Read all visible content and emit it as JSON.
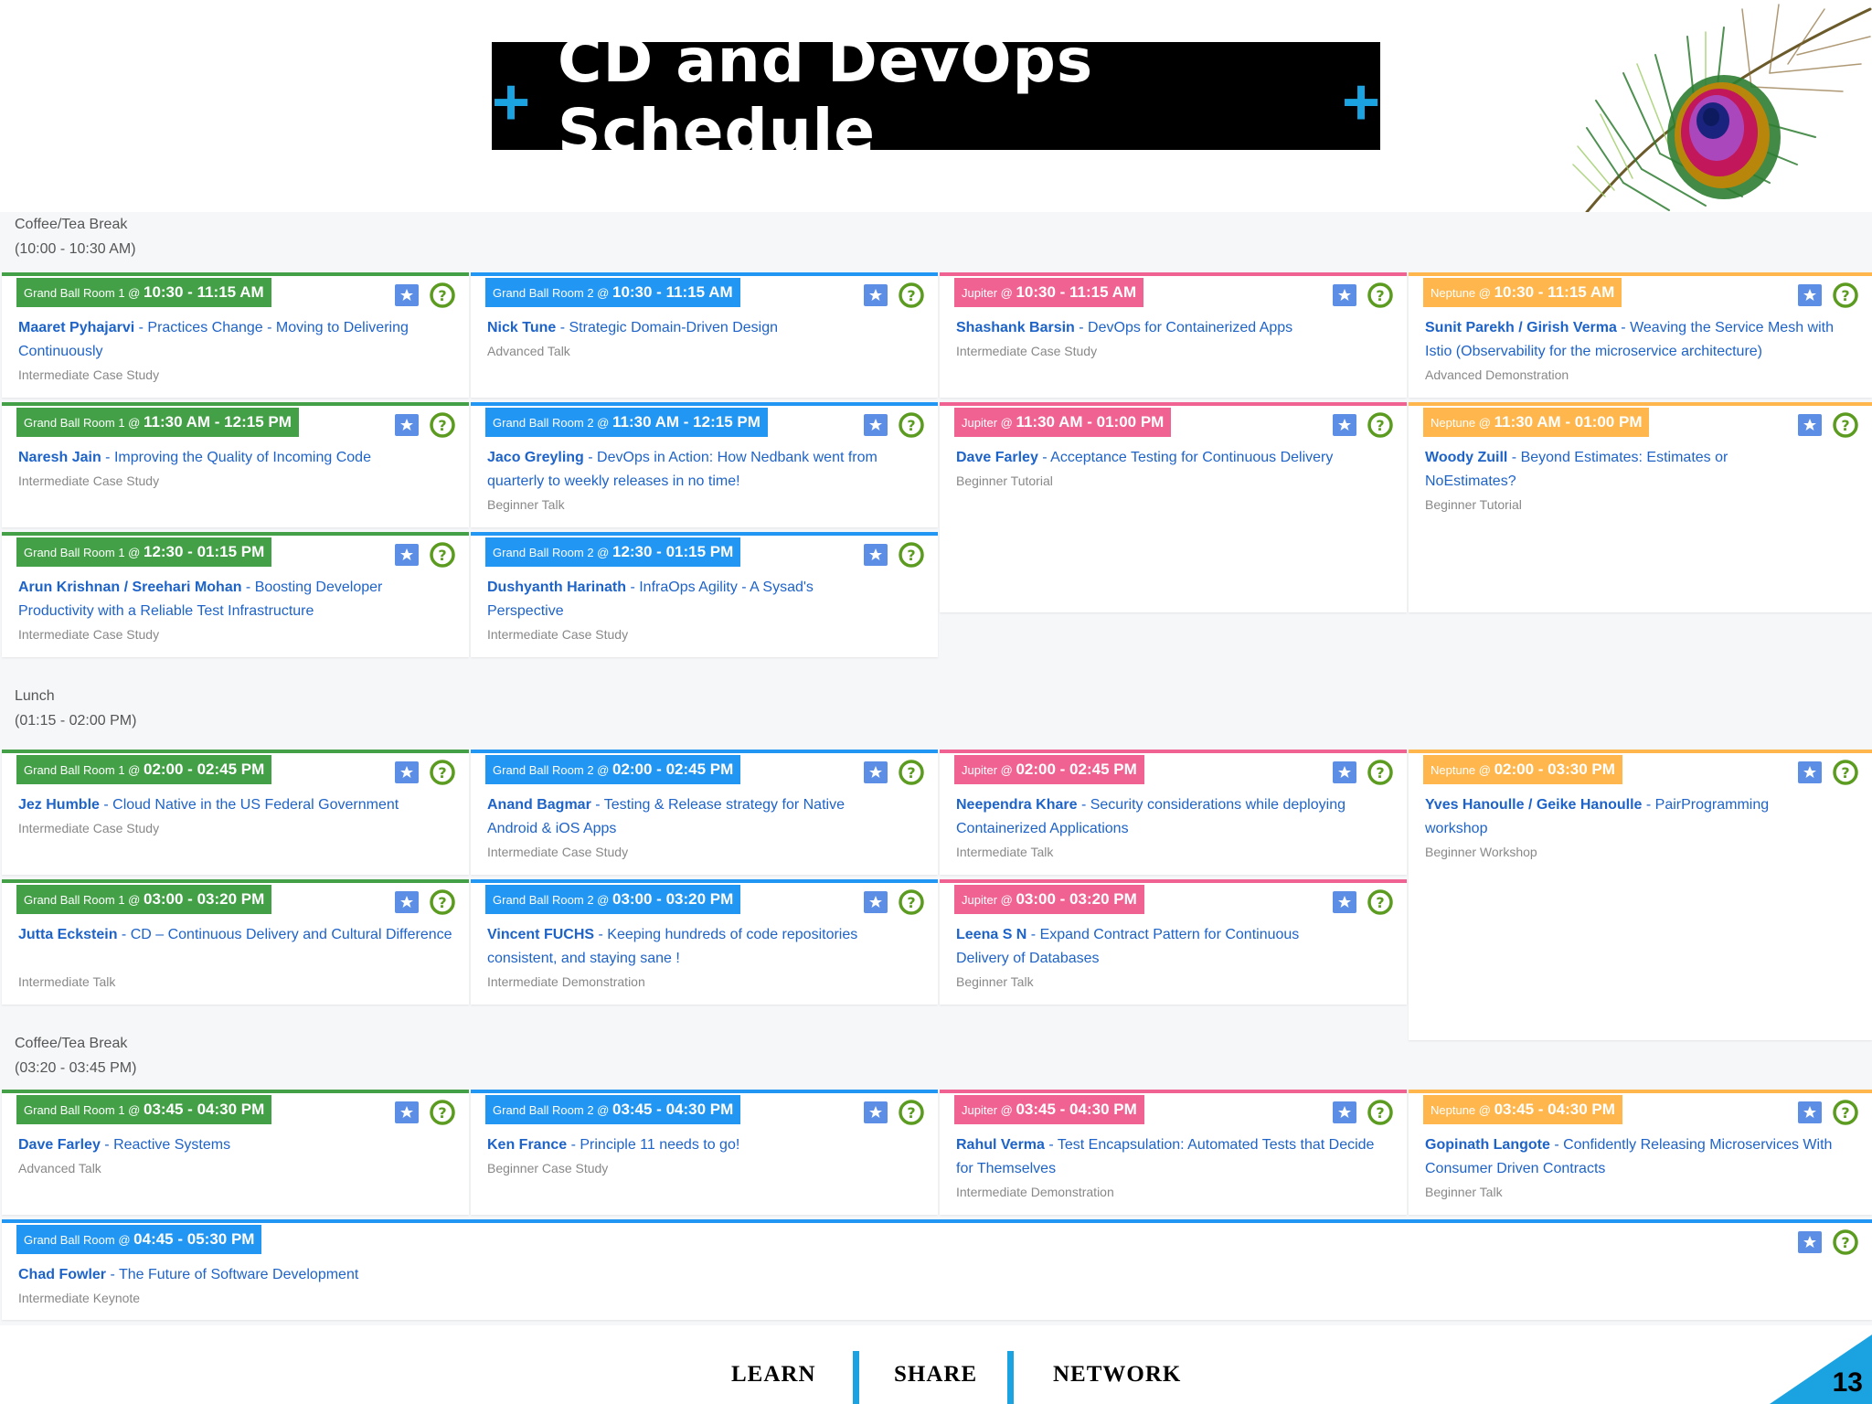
{
  "title": {
    "text": "CD and DevOps Schedule",
    "plus": "+"
  },
  "breaks": [
    {
      "name": "Coffee/Tea Break",
      "time": "(10:00 - 10:30 AM)"
    },
    {
      "name": "Lunch",
      "time": "(01:15 - 02:00 PM)"
    },
    {
      "name": "Coffee/Tea Break",
      "time": "(03:20 - 03:45 PM)"
    }
  ],
  "sessions": [
    {
      "room": "Grand Ball Room 1 @",
      "time": "10:30 - 11:15 AM",
      "speaker": "Maaret Pyhajarvi",
      "title": " - Practices Change - Moving to Delivering Continuously",
      "level": "Intermediate Case Study"
    },
    {
      "room": "Grand Ball Room 2 @",
      "time": "10:30 - 11:15 AM",
      "speaker": "Nick Tune",
      "title": " - Strategic Domain-Driven Design",
      "level": "Advanced Talk"
    },
    {
      "room": "Jupiter @",
      "time": "10:30 - 11:15 AM",
      "speaker": "Shashank Barsin",
      "title": " - DevOps for Containerized Apps",
      "level": "Intermediate Case Study"
    },
    {
      "room": "Neptune @",
      "time": "10:30 - 11:15 AM",
      "speaker": "Sunit Parekh / Girish Verma",
      "title": " - Weaving the Service Mesh with Istio (Observability for the microservice architecture)",
      "level": "Advanced Demonstration"
    },
    {
      "room": "Grand Ball Room 1 @",
      "time": "11:30 AM - 12:15 PM",
      "speaker": "Naresh Jain",
      "title": " - Improving the Quality of Incoming Code",
      "level": "Intermediate Case Study"
    },
    {
      "room": "Grand Ball Room 2 @",
      "time": "11:30 AM - 12:15 PM",
      "speaker": "Jaco Greyling",
      "title": " - DevOps in Action: How Nedbank went from quarterly to weekly releases in no time!",
      "level": "Beginner Talk"
    },
    {
      "room": "Jupiter @",
      "time": "11:30 AM - 01:00 PM",
      "speaker": "Dave Farley",
      "title": " - Acceptance Testing for Continuous Delivery",
      "level": "Beginner Tutorial"
    },
    {
      "room": "Neptune @",
      "time": "11:30 AM - 01:00 PM",
      "speaker": "Woody Zuill",
      "title": " - Beyond Estimates: Estimates or NoEstimates?",
      "level": "Beginner Tutorial"
    },
    {
      "room": "Grand Ball Room 1 @",
      "time": "12:30 - 01:15 PM",
      "speaker": "Arun Krishnan / Sreehari Mohan",
      "title": " - Boosting Developer Productivity with a Reliable Test Infrastructure",
      "level": "Intermediate Case Study"
    },
    {
      "room": "Grand Ball Room 2 @",
      "time": "12:30 - 01:15 PM",
      "speaker": "Dushyanth Harinath",
      "title": " - InfraOps Agility - A Sysad's Perspective",
      "level": "Intermediate Case Study"
    },
    {
      "room": "Grand Ball Room 1 @",
      "time": "02:00 - 02:45 PM",
      "speaker": "Jez Humble",
      "title": " - Cloud Native in the US Federal Government",
      "level": "Intermediate Case Study"
    },
    {
      "room": "Grand Ball Room 2 @",
      "time": "02:00 - 02:45 PM",
      "speaker": "Anand Bagmar",
      "title": " - Testing & Release strategy for Native Android & iOS Apps",
      "level": "Intermediate Case Study"
    },
    {
      "room": "Jupiter @",
      "time": "02:00 - 02:45 PM",
      "speaker": "Neependra Khare",
      "title": " - Security considerations while deploying Containerized Applications",
      "level": "Intermediate Talk"
    },
    {
      "room": "Neptune @",
      "time": "02:00 - 03:30 PM",
      "speaker": "Yves Hanoulle / Geike Hanoulle",
      "title": " - PairProgramming workshop",
      "level": "Beginner Workshop"
    },
    {
      "room": "Grand Ball Room 1 @",
      "time": "03:00 - 03:20 PM",
      "speaker": "Jutta Eckstein",
      "title": " - CD – Continuous Delivery and Cultural Difference",
      "level": "Intermediate Talk"
    },
    {
      "room": "Grand Ball Room 2 @",
      "time": "03:00 - 03:20 PM",
      "speaker": "Vincent FUCHS",
      "title": " - Keeping hundreds of code repositories consistent, and staying sane !",
      "level": "Intermediate Demonstration"
    },
    {
      "room": "Jupiter @",
      "time": "03:00 - 03:20 PM",
      "speaker": "Leena S N",
      "title": " - Expand Contract Pattern for Continuous Delivery of Databases",
      "level": "Beginner Talk"
    },
    {
      "room": "Grand Ball Room 1 @",
      "time": "03:45 - 04:30 PM",
      "speaker": "Dave Farley",
      "title": " - Reactive Systems",
      "level": "Advanced Talk"
    },
    {
      "room": "Grand Ball Room 2 @",
      "time": "03:45 - 04:30 PM",
      "speaker": "Ken France",
      "title": " - Principle 11 needs to go!",
      "level": "Beginner Case Study"
    },
    {
      "room": "Jupiter @",
      "time": "03:45 - 04:30 PM",
      "speaker": "Rahul Verma",
      "title": " - Test Encapsulation: Automated Tests that Decide for Themselves",
      "level": "Intermediate Demonstration"
    },
    {
      "room": "Neptune @",
      "time": "03:45 - 04:30 PM",
      "speaker": "Gopinath Langote",
      "title": " - Confidently Releasing Microservices With Consumer Driven Contracts",
      "level": "Beginner Talk"
    },
    {
      "room": "Grand Ball Room @",
      "time": "04:45 - 05:30 PM",
      "speaker": "Chad Fowler",
      "title": " - The Future of Software Development",
      "level": "Intermediate Keynote"
    }
  ],
  "footer": {
    "learn": "LEARN",
    "share": "SHARE",
    "network": "NETWORK",
    "page": "13"
  },
  "colors": {
    "grand1": "#43a047",
    "grand2": "#2196f3",
    "jupiter": "#f06292",
    "neptune": "#ffb74d",
    "accent": "#1aa3e0"
  }
}
